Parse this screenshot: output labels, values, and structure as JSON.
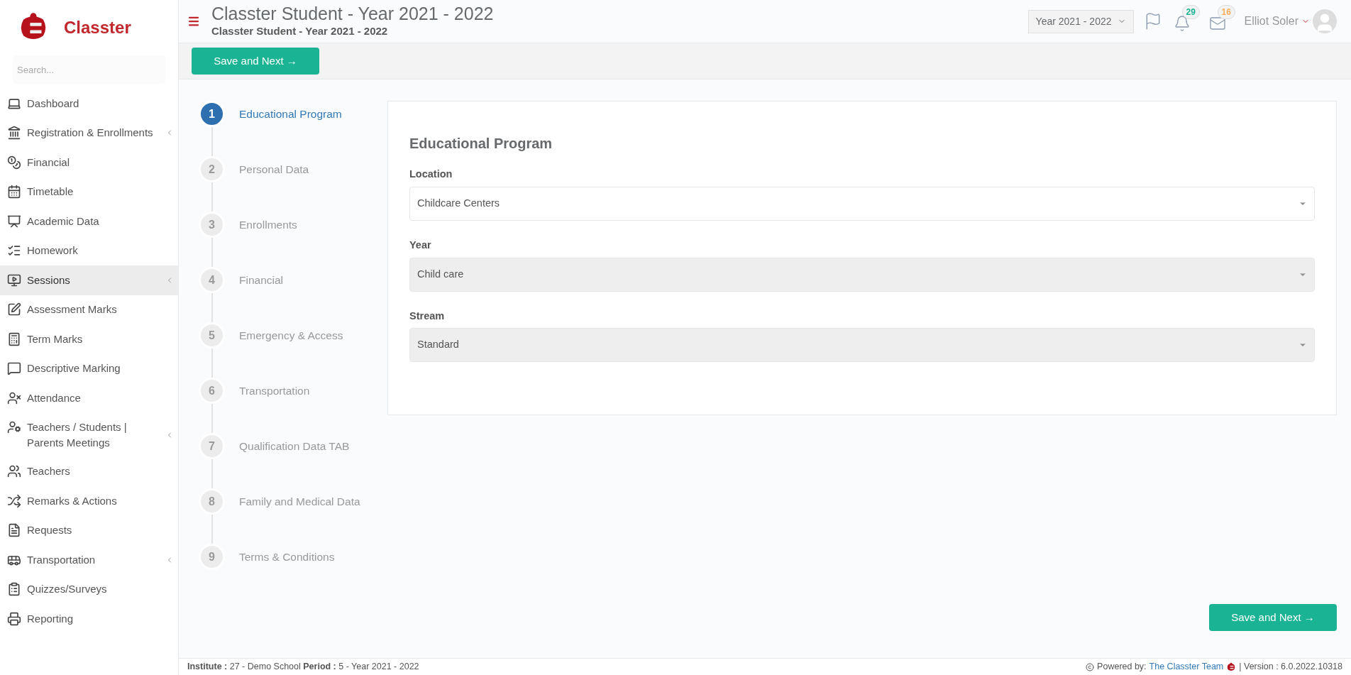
{
  "brand": {
    "name": "Classter"
  },
  "sidebar": {
    "search_placeholder": "Search...",
    "items": [
      {
        "label": "Dashboard",
        "selected": false,
        "has_submenu": false
      },
      {
        "label": "Registration & Enrollments",
        "selected": false,
        "has_submenu": true
      },
      {
        "label": "Financial",
        "selected": false,
        "has_submenu": false
      },
      {
        "label": "Timetable",
        "selected": false,
        "has_submenu": false
      },
      {
        "label": "Academic Data",
        "selected": false,
        "has_submenu": false
      },
      {
        "label": "Homework",
        "selected": false,
        "has_submenu": false
      },
      {
        "label": "Sessions",
        "selected": true,
        "has_submenu": true
      },
      {
        "label": "Assessment Marks",
        "selected": false,
        "has_submenu": false
      },
      {
        "label": "Term Marks",
        "selected": false,
        "has_submenu": false
      },
      {
        "label": "Descriptive Marking",
        "selected": false,
        "has_submenu": false
      },
      {
        "label": "Attendance",
        "selected": false,
        "has_submenu": false
      },
      {
        "label": "Teachers / Students | Parents Meetings",
        "selected": false,
        "has_submenu": true
      },
      {
        "label": "Teachers",
        "selected": false,
        "has_submenu": false
      },
      {
        "label": "Remarks & Actions",
        "selected": false,
        "has_submenu": false
      },
      {
        "label": "Requests",
        "selected": false,
        "has_submenu": false
      },
      {
        "label": "Transportation",
        "selected": false,
        "has_submenu": true
      },
      {
        "label": "Quizzes/Surveys",
        "selected": false,
        "has_submenu": false
      },
      {
        "label": "Reporting",
        "selected": false,
        "has_submenu": false
      }
    ]
  },
  "header": {
    "title": "Classter Student - Year 2021 - 2022",
    "subtitle": "Classter Student - Year 2021 - 2022",
    "year_selector": "Year 2021 - 2022",
    "notifications": [
      {
        "kind": "bell",
        "count": "29",
        "color": "#1ab394"
      },
      {
        "kind": "mail",
        "count": "16",
        "color": "#f8ac59"
      }
    ],
    "user": "Elliot Soler"
  },
  "toolbar": {
    "button": "Save and Next →"
  },
  "steps": [
    {
      "number": "1",
      "label": "Educational Program",
      "selected": true
    },
    {
      "number": "2",
      "label": "Personal Data",
      "selected": false
    },
    {
      "number": "3",
      "label": "Enrollments",
      "selected": false
    },
    {
      "number": "4",
      "label": "Financial",
      "selected": false
    },
    {
      "number": "5",
      "label": "Emergency & Access",
      "selected": false
    },
    {
      "number": "6",
      "label": "Transportation",
      "selected": false
    },
    {
      "number": "7",
      "label": "Qualification Data TAB",
      "selected": false
    },
    {
      "number": "8",
      "label": "Family and Medical Data",
      "selected": false
    },
    {
      "number": "9",
      "label": "Terms & Conditions",
      "selected": false
    }
  ],
  "form": {
    "title": "Educational Program",
    "fields": [
      {
        "label": "Location",
        "value": "Childcare Centers",
        "disabled": false
      },
      {
        "label": "Year",
        "value": "Child care",
        "disabled": true
      },
      {
        "label": "Stream",
        "value": "Standard",
        "disabled": true
      }
    ]
  },
  "bottom_button": "Save and Next →",
  "footer": {
    "info": "**Institute :** 27 - Demo School **Period :** 5 - Year 2021 - 2022",
    "powered_by": "Powered by:",
    "team_link": "The Classter Team",
    "version": "| Version : 6.0.2022.10318"
  }
}
